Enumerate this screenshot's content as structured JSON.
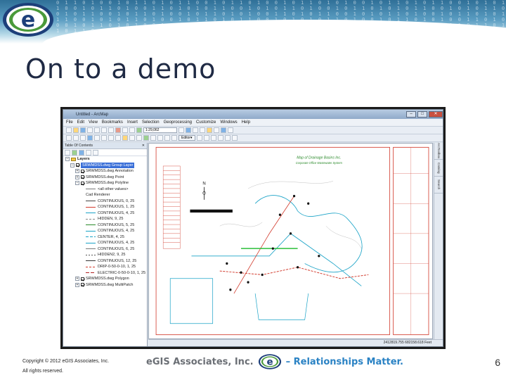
{
  "slide": {
    "title": "On to a demo",
    "page_number": "6",
    "copyright_line1": "Copyright © 2012 eGIS Associates, Inc.",
    "copyright_line2": "All rights reserved.",
    "company_name": "eGIS Associates, Inc.",
    "tagline": "– Relationships Matter.",
    "logo_letter": "e",
    "brand_colors": {
      "navy": "#1d3f7a",
      "blue": "#2a82c4",
      "green": "#4a9a3a",
      "gray": "#6b6f75"
    }
  },
  "app": {
    "window_title": "Untitled - ArcMap",
    "menu": [
      "File",
      "Edit",
      "View",
      "Bookmarks",
      "Insert",
      "Selection",
      "Geoprocessing",
      "Customize",
      "Windows",
      "Help"
    ],
    "scale_value": "1:29,062",
    "editor_label": "Editor▾",
    "toc": {
      "title": "Table Of Contents",
      "close": "✕",
      "items": [
        {
          "label": "Layers",
          "bold": true
        },
        {
          "label": "SRWMDSS.dwg Group Layer",
          "selected": true
        },
        {
          "label": "SRWMDSS.dwg Annotation"
        },
        {
          "label": "SRWMDSS.dwg Point"
        },
        {
          "label": "SRWMDSS.dwg Polyline"
        },
        {
          "label": "<all other values>"
        },
        {
          "label": "Cad Renderer"
        },
        {
          "label": "CONTINUOUS, 0, 25"
        },
        {
          "label": "CONTINUOUS, 1, 25"
        },
        {
          "label": "CONTINUOUS, 4, 25"
        },
        {
          "label": "HIDDEN, 9, 25"
        },
        {
          "label": "CONTINUOUS, 5, 25"
        },
        {
          "label": "CONTINUOUS, 4, 25"
        },
        {
          "label": "CENTER, 4, 25"
        },
        {
          "label": "CONTINUOUS, 4, 25"
        },
        {
          "label": "CONTINUOUS, 6, 25"
        },
        {
          "label": "HIDDEN2, 9, 25"
        },
        {
          "label": "CONTINUOUS, 12, 25"
        },
        {
          "label": "DRIP-0-50-0-10, 1, 25"
        },
        {
          "label": "ELECTRIC-0-50-0-10, 1, 25"
        },
        {
          "label": "SRWMDSS.dwg Polygon"
        },
        {
          "label": "SRWMDSS.dwg MultiPatch"
        }
      ]
    },
    "side_tabs": [
      "ArcToolbox",
      "Catalog",
      "Search"
    ],
    "status_coords": "2412819.755  682158.618 Feet",
    "map_title": "Map of Drainage Basins Inc.",
    "map_subtitle": "Corporate Office Wastewater System"
  }
}
